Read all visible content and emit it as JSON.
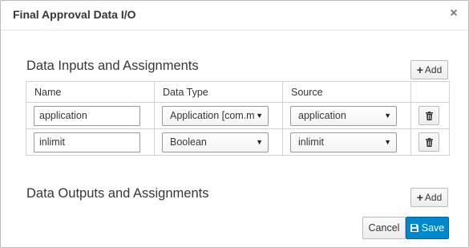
{
  "dialog": {
    "title": "Final Approval Data I/O",
    "close_label": "×"
  },
  "inputs": {
    "title": "Data Inputs and Assignments",
    "add_label": "Add",
    "columns": [
      "Name",
      "Data Type",
      "Source"
    ],
    "rows": [
      {
        "name": "application",
        "data_type": "Application [com.myspace",
        "source": "application"
      },
      {
        "name": "inlimit",
        "data_type": "Boolean",
        "source": "inlimit"
      }
    ]
  },
  "outputs": {
    "title": "Data Outputs and Assignments",
    "add_label": "Add"
  },
  "footer": {
    "cancel_label": "Cancel",
    "save_label": "Save"
  },
  "colors": {
    "primary": "#0088ce",
    "border": "#bbbbbb"
  }
}
